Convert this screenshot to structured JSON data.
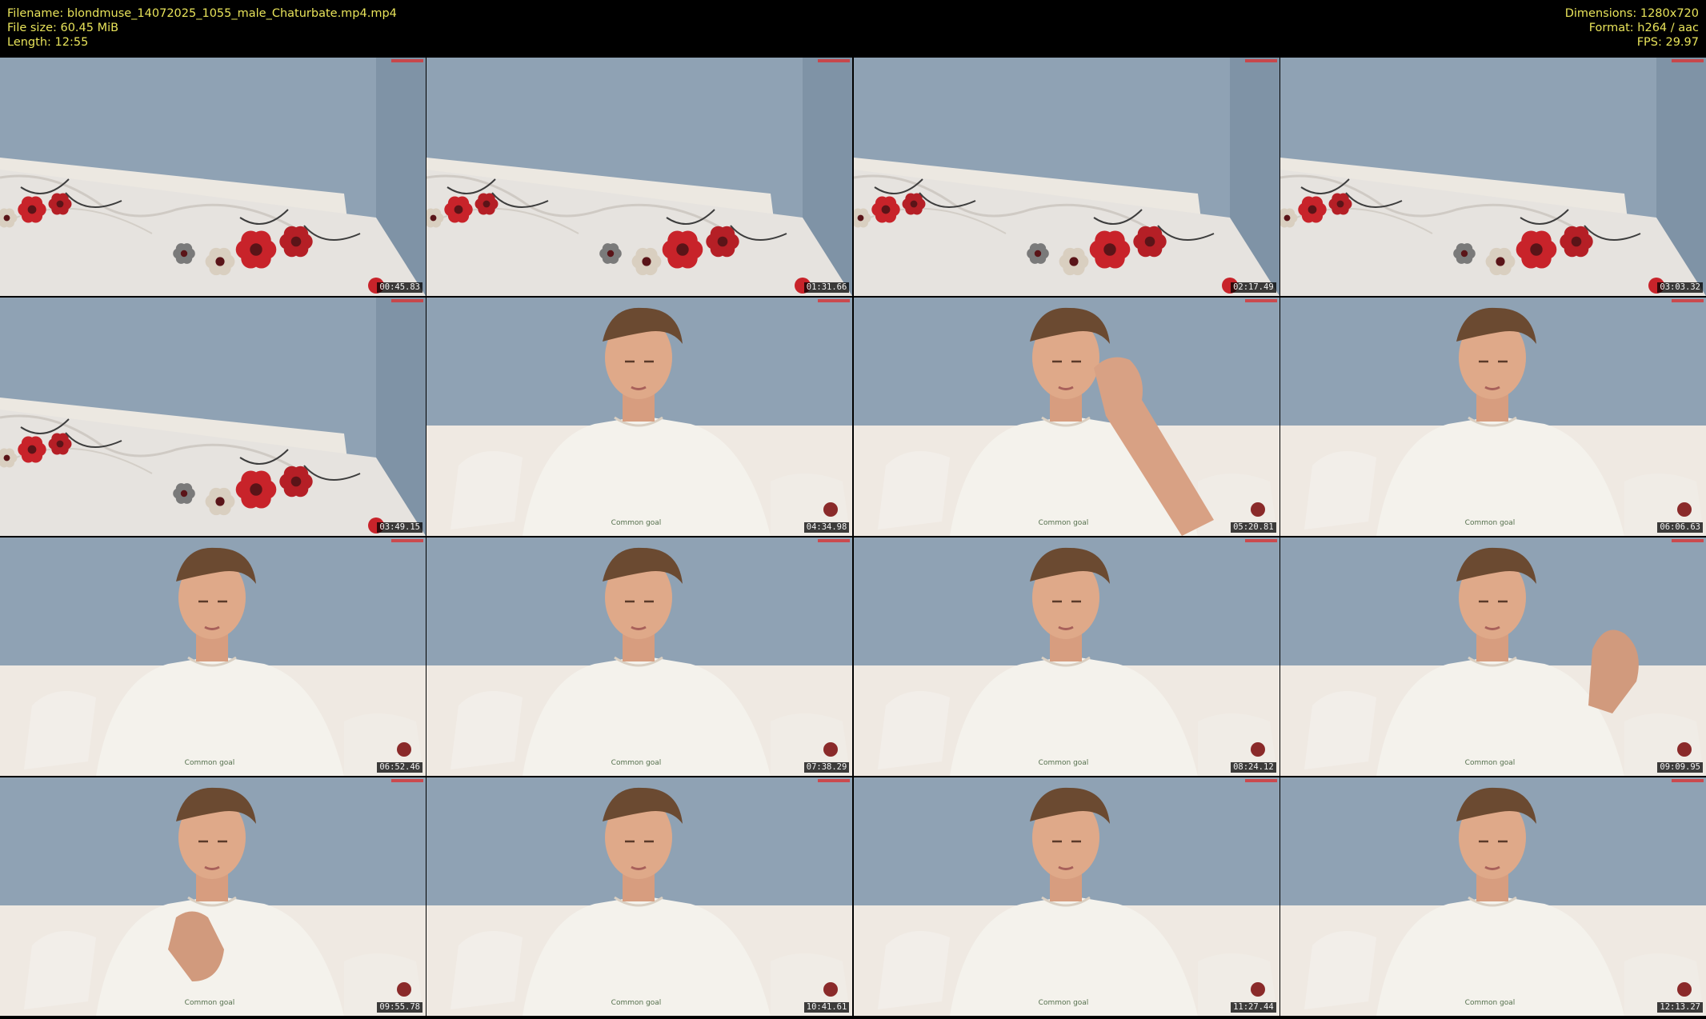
{
  "header": {
    "filename": "Filename: blondmuse_14072025_1055_male_Chaturbate.mp4.mp4",
    "filesize": "File size: 60.45 MiB",
    "length": "Length: 12:55",
    "dimensions": "Dimensions: 1280x720",
    "format": "Format: h264 / aac",
    "fps": "FPS: 29.97"
  },
  "colors": {
    "header_text": "#e8e35a",
    "wall": "#8fa2b4",
    "bedding": "#e9e7e4",
    "flower_red": "#c8232a"
  },
  "thumbnails": [
    {
      "timestamp": "00:45.83",
      "scene": "bed-only"
    },
    {
      "timestamp": "01:31.66",
      "scene": "bed-only"
    },
    {
      "timestamp": "02:17.49",
      "scene": "bed-only"
    },
    {
      "timestamp": "03:03.32",
      "scene": "bed-only"
    },
    {
      "timestamp": "03:49.15",
      "scene": "bed-only"
    },
    {
      "timestamp": "04:34.98",
      "scene": "person"
    },
    {
      "timestamp": "05:20.81",
      "scene": "person-hand-raised"
    },
    {
      "timestamp": "06:06.63",
      "scene": "person"
    },
    {
      "timestamp": "06:52.46",
      "scene": "person"
    },
    {
      "timestamp": "07:38.29",
      "scene": "person"
    },
    {
      "timestamp": "08:24.12",
      "scene": "person"
    },
    {
      "timestamp": "09:09.95",
      "scene": "person-hand-side"
    },
    {
      "timestamp": "09:55.78",
      "scene": "person-hand-chin"
    },
    {
      "timestamp": "10:41.61",
      "scene": "person"
    },
    {
      "timestamp": "11:27.44",
      "scene": "person"
    },
    {
      "timestamp": "12:13.27",
      "scene": "person"
    }
  ]
}
